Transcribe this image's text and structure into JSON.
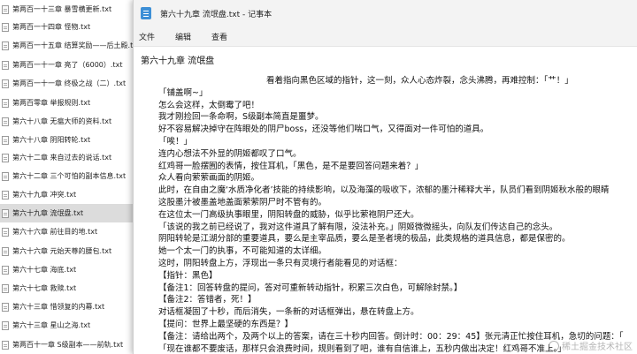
{
  "explorer": {
    "files": [
      "第两百一十三章 暴雪横更新.txt",
      "第两百一十四章 怪物.txt",
      "第两百一十五章 结算奖励——后土殿.txt",
      "第两百一十一章 亮了（6000）.txt",
      "第两百一十一章 终极之战（二）.txt",
      "第两百零章 举报规则.txt",
      "第六十八章 无瘟大师的资料.txt",
      "第六十八章 阴阳转轮.txt",
      "第六十二章 来自过去的说话.txt",
      "第六十二章 三个可怕的副本信息.txt",
      "第六十九章 冲突.txt",
      "第六十九章 流氓盘.txt",
      "第六十六章 前往目的地.txt",
      "第六十六章 元始天尊的腰包.txt",
      "第六十七章 海底.txt",
      "第六十七章 救赎.txt",
      "第六十三章 惜领复的内幕.txt",
      "第六十三章 星山之海.txt",
      "第两百十一章 S级副本——前轨.txt"
    ],
    "selected_index": 11
  },
  "notepad": {
    "window_title": "第六十九章 流氓盘.txt - 记事本",
    "menu": [
      "文件",
      "编辑",
      "查看"
    ],
    "lines": [
      "第六十九章 流氓盘",
      "看着指向黑色区域的指针，这一刻，众人心态炸裂，念头沸腾，再难控制：「艹！」",
      "「铺盖啊~」",
      "怎么会这样，太倒霉了吧！",
      "我才刚捡回一条命啊，S级副本简直是噩梦。",
      "好不容易解决掉守在阵眼处的阴尸boss，还没等他们喘口气，又得面对一件可怕的道具。",
      "「唉！」",
      "连内心想法不外显的阴姬都叹了口气。",
      "红鸡哥一脸摆囿的表情，按住耳机，「黑色，是不是要回答问题来着？」",
      "众人看向萦萦画面的阴姬。",
      "此时，在自由之魔‘水质净化者’技能的持续影响，以及海藻的吸收下，浓郁的墨汁稀释大半，队员们看到阴姬秋水般的眼睛",
      "这股墨汁被墨盖地盖面萦萦阴尸时不管有的。",
      "在这位太一门高级执事眼里，阴阳转盘的威胁，似乎比萦袍阴尸还大。",
      "「该说的我之前已经说了，我对这件道具了解有限，没法补充。」阴姬微微摇头，向队友们传达自己的念头。",
      "阴阳转轮是江湖分部的重要道具，要么是主宰品质，要么是圣者境的极品，此类规格的道具信息，都是保密的。",
      "她一个太一门的执事，不可能知道的太详细。",
      "这时，阴阳转盘上方，浮现出一条只有灵境行者能看见的对话框：",
      "【指针：黑色】",
      "【备注1：回答转盘的提问，答对可重新转动指针，积累三次白色，可解除封禁。】",
      "【备注2：答错者，死！】",
      "对话框凝固了十秒，而后消失，一条新的对话框弹出，悬在转盘上方。",
      "【提问：世界上最坚硬的东西是？】",
      "【备注：请给出两个，及两个以上的答案，请在三十秒内回答。倒计时：00：29：45】张元清正忙按住耳机，急切的问题：「",
      "「现在谁都不要废话，那样只会浪费时间，规则看到了吧，谁有自信谁上，五秒内做出决定！红鸡哥不准上。」"
    ],
    "watermark": "稀土掘金技术社区"
  }
}
